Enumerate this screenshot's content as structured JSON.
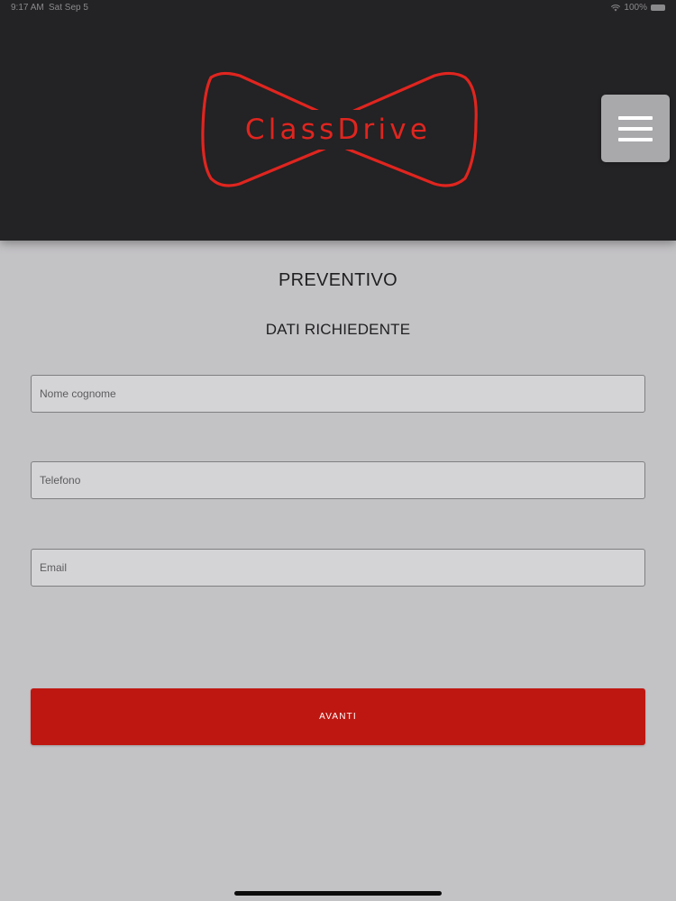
{
  "status_bar": {
    "time": "9:17 AM",
    "date": "Sat Sep 5",
    "battery": "100%"
  },
  "header": {
    "logo_text": "ClassDrive",
    "menu_icon": "hamburger-menu-icon"
  },
  "form": {
    "title": "PREVENTIVO",
    "section_title": "DATI RICHIEDENTE",
    "fields": [
      {
        "placeholder": "Nome cognome",
        "value": ""
      },
      {
        "placeholder": "Telefono",
        "value": ""
      },
      {
        "placeholder": "Email",
        "value": ""
      }
    ],
    "submit_label": "AVANTI"
  },
  "colors": {
    "header_bg": "#232224",
    "page_bg": "#c3c2c5",
    "brand_red": "#e0251f",
    "button_red": "#be1711",
    "menu_button_bg": "#a9a8ab"
  }
}
